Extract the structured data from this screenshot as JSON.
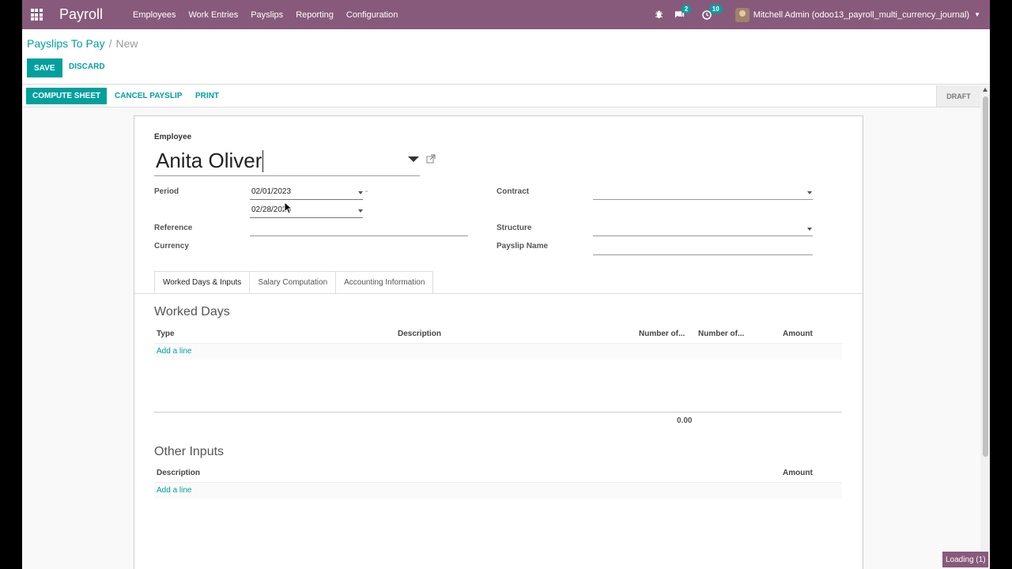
{
  "navbar": {
    "brand": "Payroll",
    "menu": [
      "Employees",
      "Work Entries",
      "Payslips",
      "Reporting",
      "Configuration"
    ],
    "messages_badge": "2",
    "activities_badge": "10",
    "user": "Mitchell Admin (odoo13_payroll_multi_currency_journal)"
  },
  "breadcrumb": {
    "parent": "Payslips To Pay",
    "current": "New"
  },
  "buttons": {
    "save": "SAVE",
    "discard": "DISCARD"
  },
  "statusbar": {
    "compute": "COMPUTE SHEET",
    "cancel": "CANCEL PAYSLIP",
    "print": "PRINT",
    "state": "DRAFT"
  },
  "form": {
    "employee_label": "Employee",
    "employee_value": "Anita Oliver",
    "period_label": "Period",
    "date_from": "02/01/2023",
    "date_sep": "-",
    "date_to": "02/28/2023",
    "contract_label": "Contract",
    "reference_label": "Reference",
    "structure_label": "Structure",
    "currency_label": "Currency",
    "payslip_name_label": "Payslip Name"
  },
  "tabs": [
    "Worked Days & Inputs",
    "Salary Computation",
    "Accounting Information"
  ],
  "worked_days": {
    "title": "Worked Days",
    "columns": [
      "Type",
      "Description",
      "Number of...",
      "Number of...",
      "Amount"
    ],
    "add_line": "Add a line",
    "total": "0.00"
  },
  "other_inputs": {
    "title": "Other Inputs",
    "columns": [
      "Description",
      "Amount"
    ],
    "add_line": "Add a line"
  },
  "loading": "Loading (1)",
  "colors": {
    "brand": "#875a7b",
    "accent": "#00a09d"
  }
}
